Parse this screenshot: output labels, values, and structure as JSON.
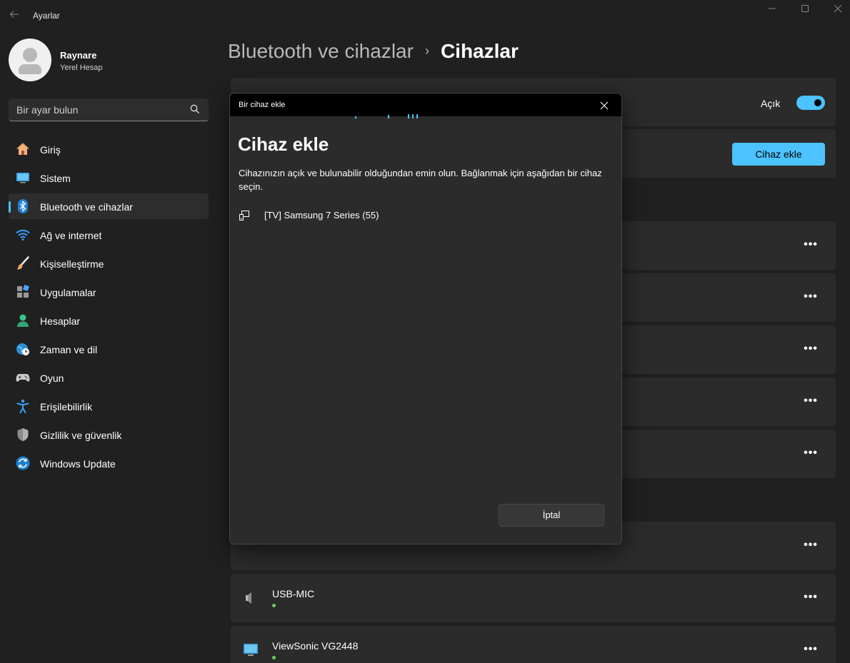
{
  "window": {
    "title": "Ayarlar",
    "back_icon": "arrow-left-icon",
    "minimize_icon": "minimize-icon",
    "maximize_icon": "maximize-icon",
    "close_icon": "close-icon"
  },
  "user": {
    "name": "Raynare",
    "account_type": "Yerel Hesap"
  },
  "search": {
    "placeholder": "Bir ayar bulun",
    "icon": "search-icon"
  },
  "sidebar": {
    "items": [
      {
        "label": "Giriş",
        "icon": "home-icon",
        "active": false
      },
      {
        "label": "Sistem",
        "icon": "monitor-icon",
        "active": false
      },
      {
        "label": "Bluetooth ve cihazlar",
        "icon": "bluetooth-icon",
        "active": true
      },
      {
        "label": "Ağ ve internet",
        "icon": "wifi-icon",
        "active": false
      },
      {
        "label": "Kişiselleştirme",
        "icon": "brush-icon",
        "active": false
      },
      {
        "label": "Uygulamalar",
        "icon": "apps-icon",
        "active": false
      },
      {
        "label": "Hesaplar",
        "icon": "person-icon",
        "active": false
      },
      {
        "label": "Zaman ve dil",
        "icon": "globe-clock-icon",
        "active": false
      },
      {
        "label": "Oyun",
        "icon": "gamepad-icon",
        "active": false
      },
      {
        "label": "Erişilebilirlik",
        "icon": "accessibility-icon",
        "active": false
      },
      {
        "label": "Gizlilik ve güvenlik",
        "icon": "shield-icon",
        "active": false
      },
      {
        "label": "Windows Update",
        "icon": "update-icon",
        "active": false
      }
    ],
    "accent_color": "#4cc2ff"
  },
  "breadcrumb": {
    "parent": "Bluetooth ve cihazlar",
    "separator": "›",
    "current": "Cihazlar"
  },
  "main": {
    "bluetooth_toggle_label": "Açık",
    "bluetooth_on": true,
    "add_device_label": "Cihaz ekle",
    "more_label": "•••",
    "devices": [
      {
        "name": "USB-MIC",
        "icon": "speaker-icon",
        "connected": true
      },
      {
        "name": "ViewSonic VG2448",
        "icon": "monitor-icon",
        "connected": true
      }
    ]
  },
  "dialog": {
    "window_title": "Bir cihaz ekle",
    "heading": "Cihaz ekle",
    "description": "Cihazınızın açık ve bulunabilir olduğundan emin olun. Bağlanmak için aşağıdan bir cihaz seçin.",
    "found_devices": [
      {
        "name": "[TV] Samsung 7 Series (55)",
        "icon": "cast-display-icon"
      }
    ],
    "cancel_label": "İptal"
  },
  "colors": {
    "background": "#202020",
    "card": "#2b2b2b",
    "accent": "#4cc2ff",
    "status_green": "#6ccb5f"
  }
}
